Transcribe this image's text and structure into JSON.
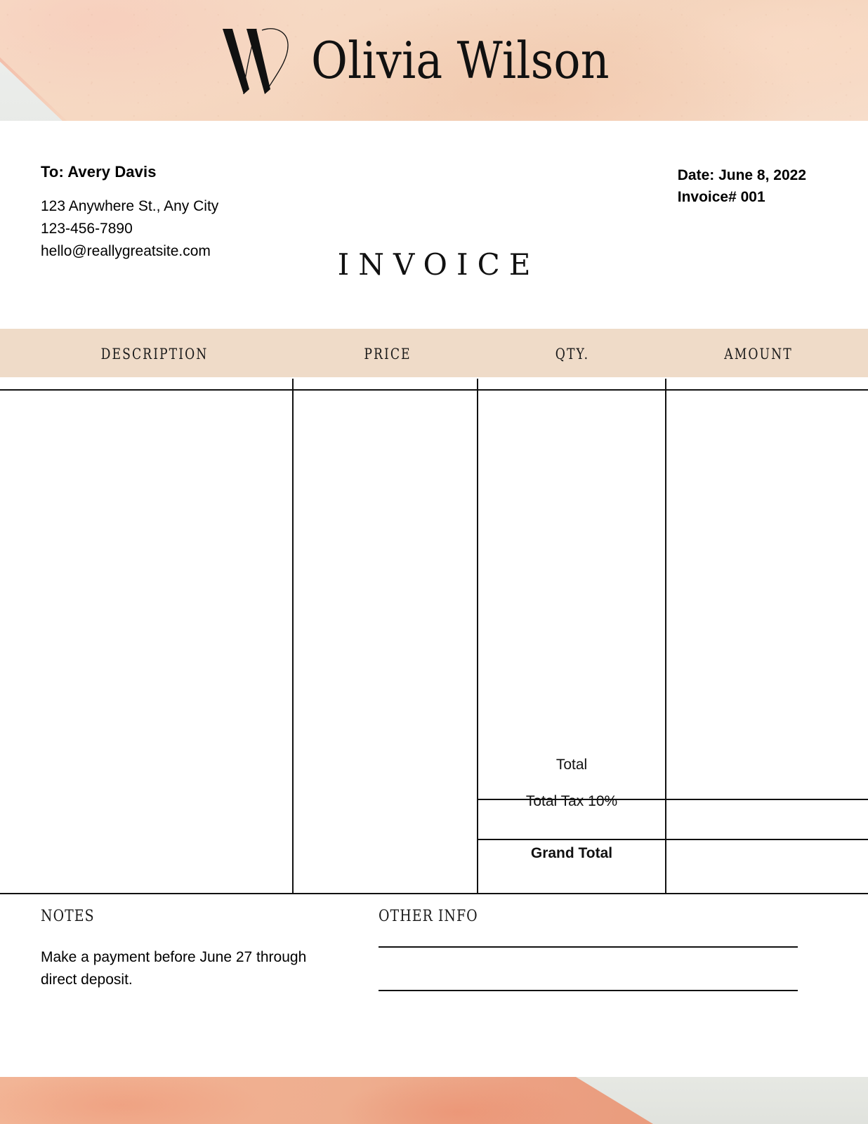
{
  "brand": {
    "monogram": "W",
    "monogram_icon": "monogram-w-icon",
    "name": "Olivia Wilson"
  },
  "bill_to": {
    "name": "To: Avery Davis",
    "address": "123 Anywhere St., Any City",
    "phone": "123-456-7890",
    "email": "hello@reallygreatsite.com"
  },
  "meta": {
    "date": "Date: June 8, 2022",
    "invoice_number": "Invoice# 001"
  },
  "document": {
    "title": "INVOICE"
  },
  "table": {
    "columns": [
      "DESCRIPTION",
      "PRICE",
      "QTY.",
      "AMOUNT"
    ],
    "rows": [],
    "totals": [
      {
        "label": "Total",
        "value": ""
      },
      {
        "label": "Total Tax 10%",
        "value": ""
      },
      {
        "label": "Grand Total",
        "value": ""
      }
    ]
  },
  "footer": {
    "notes_title": "NOTES",
    "notes_body": "Make a payment before June 27 through direct deposit.",
    "other_info_title": "OTHER INFO",
    "other_info_lines": [
      "",
      ""
    ]
  },
  "colors": {
    "header_band": "#f6d8c2",
    "table_header": "#efdbc8",
    "rule": "#111111",
    "footer_coral": "#eeae8f",
    "footer_grey": "#e3e5e0"
  }
}
